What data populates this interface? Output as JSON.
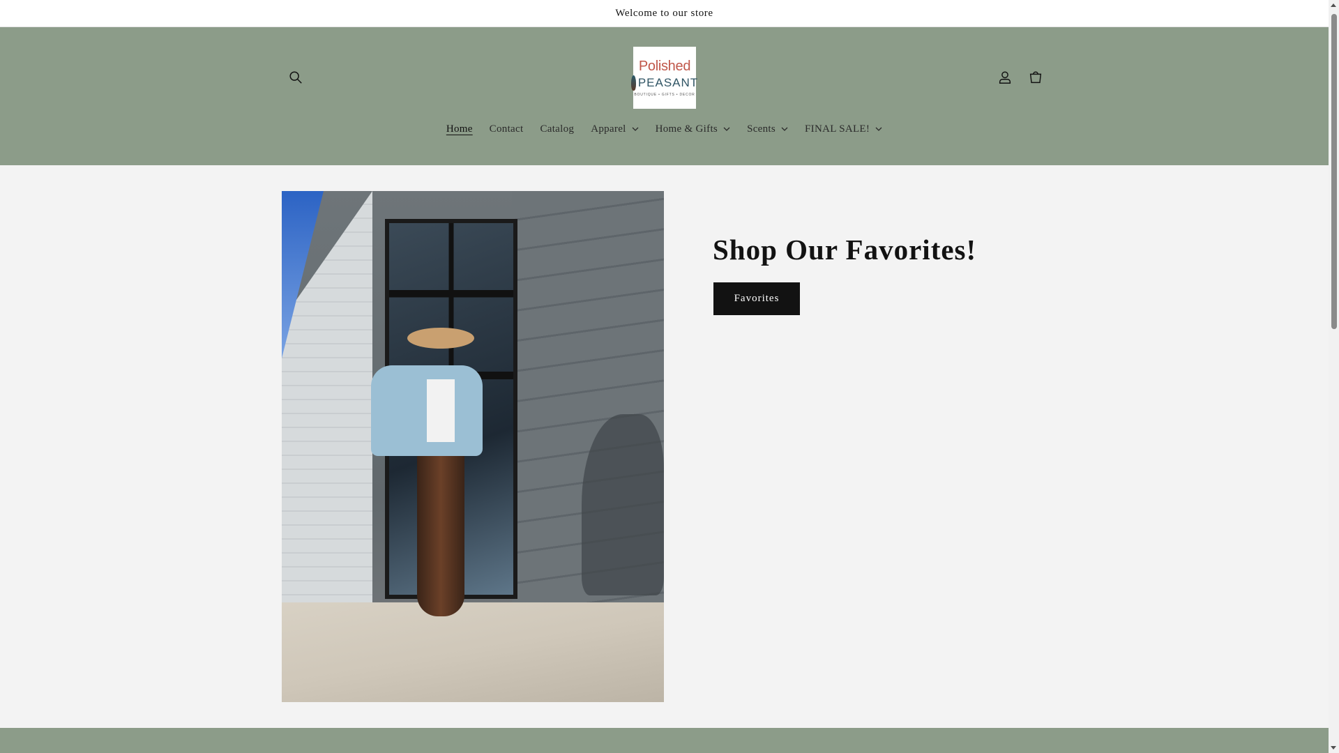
{
  "announcement": {
    "text": "Welcome to our store"
  },
  "header": {
    "search_icon": "search-icon",
    "account_icon": "account-icon",
    "cart_icon": "cart-icon",
    "logo": {
      "line1": "Polished",
      "line2": "PEASANT",
      "tagline": "BOUTIQUE • GIFTS • DECOR"
    },
    "background_color": "#8c9c89"
  },
  "nav": {
    "items": [
      {
        "label": "Home",
        "active": true,
        "dropdown": false
      },
      {
        "label": "Contact",
        "active": false,
        "dropdown": false
      },
      {
        "label": "Catalog",
        "active": false,
        "dropdown": false
      },
      {
        "label": "Apparel",
        "active": false,
        "dropdown": true
      },
      {
        "label": "Home & Gifts",
        "active": false,
        "dropdown": true
      },
      {
        "label": "Scents",
        "active": false,
        "dropdown": true
      },
      {
        "label": "FINAL SALE!",
        "active": false,
        "dropdown": true
      }
    ]
  },
  "hero": {
    "heading": "Shop Our Favorites!",
    "button_label": "Favorites"
  },
  "colors": {
    "page_bg": "#f3f3f3",
    "accent": "#8c9c89",
    "button_bg": "#121212"
  }
}
